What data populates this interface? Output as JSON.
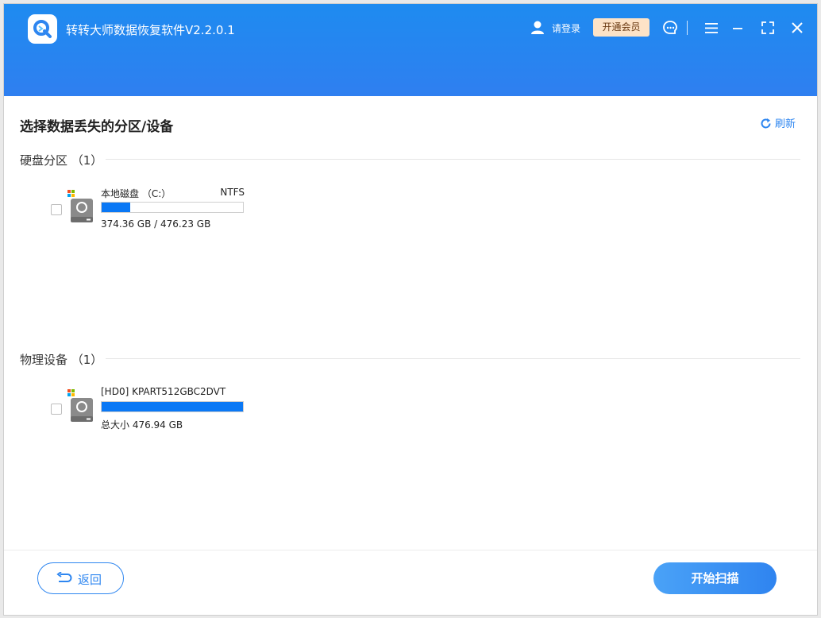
{
  "app": {
    "title": "转转大师数据恢复软件V2.2.0.1",
    "login_label": "请登录",
    "vip_label": "开通会员"
  },
  "page": {
    "title": "选择数据丢失的分区/设备",
    "refresh_label": "刷新"
  },
  "sections": {
    "partitions": {
      "label": "硬盘分区 （1）",
      "devices": [
        {
          "name": "本地磁盘 （C:）",
          "filesystem": "NTFS",
          "size_text": "374.36 GB / 476.23 GB",
          "usage_fraction": 0.2
        }
      ]
    },
    "physical": {
      "label": "物理设备 （1）",
      "devices": [
        {
          "name": "[HD0] KPART512GBC2DVT",
          "filesystem": "",
          "size_text": "总大小 476.94 GB",
          "usage_fraction": 1.0
        }
      ]
    }
  },
  "footer": {
    "back_label": "返回",
    "scan_label": "开始扫描"
  },
  "colors": {
    "accent": "#2e86f0",
    "bar_fill": "#0a78f5",
    "vip_bg": "#fde3c7"
  },
  "icons": [
    "app-logo-icon",
    "user-icon",
    "chat-icon",
    "menu-icon",
    "minimize-icon",
    "maximize-icon",
    "close-icon",
    "refresh-icon",
    "windows-icon",
    "disk-icon",
    "back-arrow-icon"
  ]
}
